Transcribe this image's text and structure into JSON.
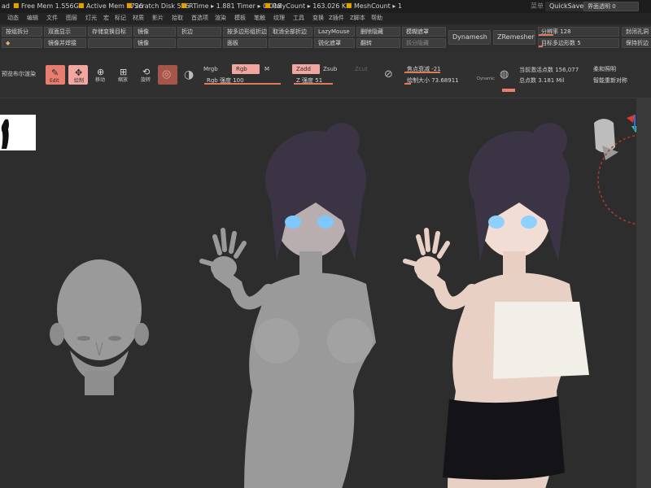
{
  "statusbar": {
    "app": "ad",
    "free_mem": "Free Mem 1.556GB",
    "active_mem": "Active Mem 2726",
    "scratch": "Scratch Disk 536",
    "rtime": "RTime ▸ 1.881 Timer ▸ 0.018",
    "polycount": "PolyCount ▸ 163.026 KP",
    "meshcount": "MeshCount ▸ 1",
    "quicksave": "QuickSave",
    "transparency_label": "界面透明 0",
    "menu_marker": "菜单"
  },
  "menubar": {
    "items": [
      "动态",
      "编辑",
      "文件",
      "图层",
      "灯光",
      "宏",
      "标记",
      "材质",
      "影片",
      "拾取",
      "首选项",
      "渲染",
      "模板",
      "笔触",
      "纹理",
      "工具",
      "变换",
      "Z插件",
      "Z脚本",
      "帮助"
    ]
  },
  "toolbar1": {
    "r1": [
      "按组拆分",
      "双面显示",
      "存储变换目标",
      "镜像",
      "折边",
      "按多边形组折边",
      "取消全部折边",
      "LazyMouse",
      "删除隐藏",
      "模糊遮罩"
    ],
    "r2": [
      "镜像并焊接",
      "",
      "镜像",
      "",
      "面板",
      "",
      "锐化遮罩",
      "",
      "翻转",
      "拆分隐藏"
    ],
    "dynamesh": "Dynamesh",
    "zremesher": "ZRemesher",
    "resolution": "分辨率 128",
    "target_poly": "目标多边形数 5",
    "pin_hole": "封闭孔洞",
    "keep_crease": "保持折边"
  },
  "toolbar2": {
    "preview_label": "预览布尔渲染",
    "tools": [
      {
        "icon": "edit-icon",
        "label": "Edit"
      },
      {
        "icon": "draw-icon",
        "label": "绘制"
      },
      {
        "icon": "move-icon",
        "label": "移动"
      },
      {
        "icon": "scale-icon",
        "label": "缩放"
      },
      {
        "icon": "rotate-icon",
        "label": "旋转"
      }
    ],
    "mrgb": "Mrgb",
    "rgb": "Rgb",
    "m": "M",
    "rgb_intensity": "Rgb 强度 100",
    "zadd": "Zadd",
    "zsub": "Zsub",
    "zcut": "Zcut",
    "z_intensity": "Z 强度 51",
    "focal_shift": "焦点衰减 -21",
    "draw_size": "绘制大小 73.68911",
    "dynamic": "Dynamic",
    "active_points": "当前激活点数 156,077",
    "total_points": "总点数 3.181 Mil",
    "smooth_light": "柔和照明",
    "smart_resym": "智能重新对称"
  },
  "viewport": {
    "colors": {
      "background": "#2d2d2d",
      "clay": "#9a9a9a",
      "skin": "#e8d0c4",
      "hair": "#3b3444",
      "top": "#f2efe8",
      "skirt": "#141418",
      "accent": "#e87d70"
    }
  }
}
